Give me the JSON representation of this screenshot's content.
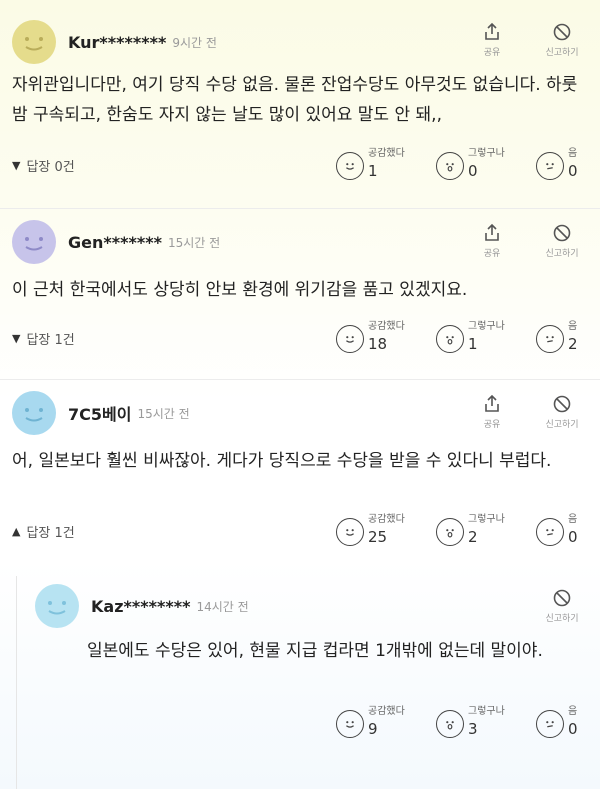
{
  "labels": {
    "share": "공유",
    "report": "신고하기",
    "empathy": "공감했다",
    "wow": "그렇구나",
    "hmm": "음"
  },
  "comments": [
    {
      "name": "Kur********",
      "time": "9시간 전",
      "text": "자위관입니다만, 여기 당직 수당 없음. 물론 잔업수당도 아무것도 없습니다. 하룻밤 구속되고, 한숨도 자지 않는 날도 많이 있어요 말도 안 돼,,",
      "reply_label": "답장 0건",
      "reply_open": false,
      "counts": [
        "1",
        "0",
        "0"
      ],
      "avatar_color": "#e5dc8c"
    },
    {
      "name": "Gen*******",
      "time": "15시간 전",
      "text": "이 근처 한국에서도 상당히 안보 환경에 위기감을 품고 있겠지요.",
      "reply_label": "답장 1건",
      "reply_open": false,
      "counts": [
        "18",
        "1",
        "2"
      ],
      "avatar_color": "#c7c4ea"
    },
    {
      "name": "7C5베이",
      "time": "15시간 전",
      "text": "어, 일본보다 훨씬 비싸잖아. 게다가 당직으로 수당을 받을 수 있다니 부럽다.",
      "reply_label": "답장 1건",
      "reply_open": true,
      "counts": [
        "25",
        "2",
        "0"
      ],
      "avatar_color": "#a8d9ef"
    }
  ],
  "reply": {
    "name": "Kaz********",
    "time": "14시간 전",
    "text": "일본에도 수당은 있어, 현물 지급 컵라면 1개밖에 없는데 말이야.",
    "counts": [
      "9",
      "3",
      "0"
    ],
    "avatar_color": "#b7e3f2"
  }
}
